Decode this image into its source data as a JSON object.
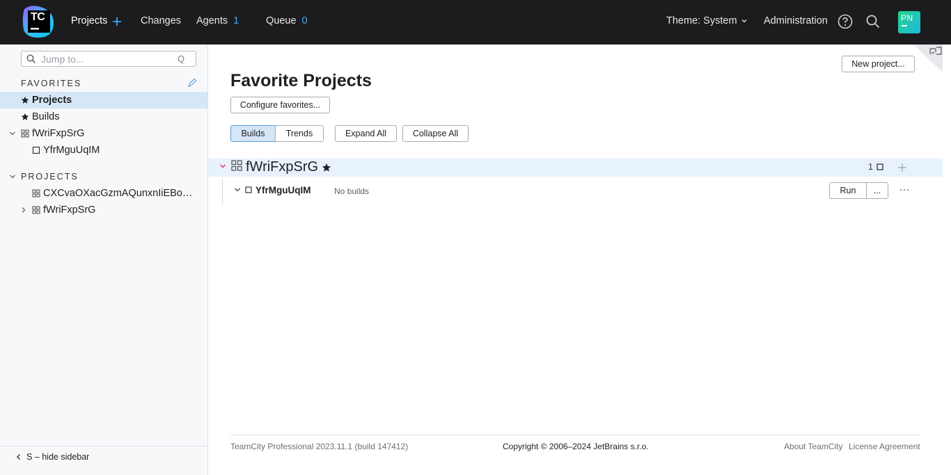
{
  "header": {
    "logo_text": "TC",
    "nav": {
      "projects": "Projects",
      "changes": "Changes",
      "agents": "Agents",
      "agents_count": "1",
      "queue": "Queue",
      "queue_count": "0"
    },
    "theme": "Theme: System",
    "administration": "Administration",
    "avatar_initials": "PN"
  },
  "sidebar": {
    "search_placeholder": "Jump to...",
    "search_shortcut": "Q",
    "favorites_label": "FAVORITES",
    "favorites": [
      {
        "label": "Projects",
        "icon": "star-icon",
        "selected": true
      },
      {
        "label": "Builds",
        "icon": "star-icon",
        "selected": false
      },
      {
        "label": "fWriFxpSrG",
        "icon": "project-icon",
        "expanded": true
      },
      {
        "label": "YfrMguUqIM",
        "icon": "build-config-icon"
      }
    ],
    "projects_label": "PROJECTS",
    "projects": [
      {
        "label": "CXCvaOXacGzmAQunxnIiEBoW…",
        "icon": "project-icon"
      },
      {
        "label": "fWriFxpSrG",
        "icon": "project-icon",
        "expanded": false
      }
    ],
    "hide_label": "S – hide sidebar"
  },
  "main": {
    "new_project": "New project...",
    "title": "Favorite Projects",
    "configure_favorites": "Configure favorites...",
    "tabs": [
      {
        "label": "Builds",
        "active": true
      },
      {
        "label": "Trends",
        "active": false
      }
    ],
    "expand_all": "Expand All",
    "collapse_all": "Collapse All",
    "project": {
      "name": "fWriFxpSrG",
      "count": "1",
      "build_config": {
        "name": "YfrMguUqIM",
        "status": "No builds",
        "run": "Run",
        "more": "..."
      }
    }
  },
  "footer": {
    "version": "TeamCity Professional 2023.11.1 (build 147412)",
    "copyright": "Copyright © 2006–2024 JetBrains s.r.o.",
    "about": "About TeamCity",
    "license": "License Agreement"
  },
  "colors": {
    "header_bg": "#1c1c1e",
    "accent_blue": "#3fa9f5",
    "selected_bg": "#d5e6f7",
    "project_row_bg": "#e8f2fc",
    "collapse_chevron": "#e0316b"
  }
}
